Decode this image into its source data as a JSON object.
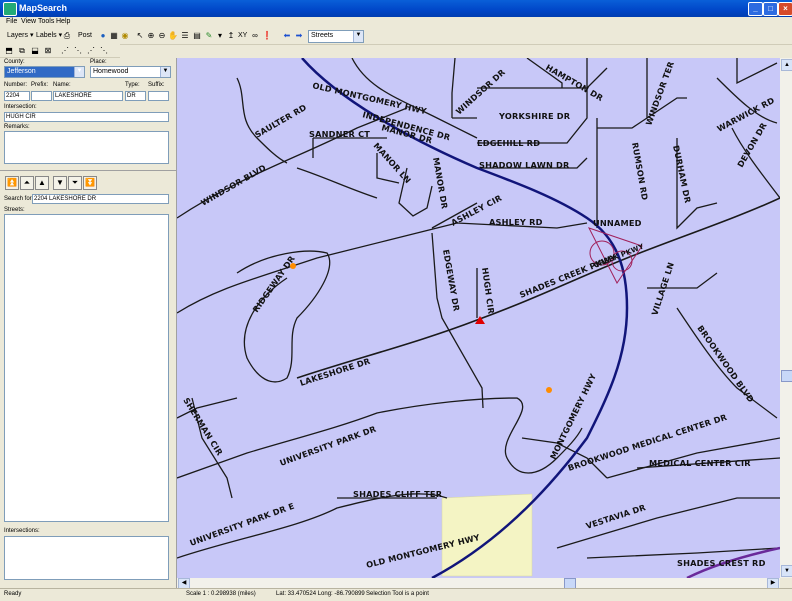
{
  "window": {
    "title": "MapSearch"
  },
  "menu": [
    "File",
    "View",
    "Tools",
    "Help"
  ],
  "toolbar": {
    "layers_label": "Layers",
    "labels_label": "Labels",
    "post_label": "Post",
    "xy_label": "XY",
    "layer_select": "Streets"
  },
  "search_panel": {
    "county_label": "County:",
    "county_value": "Jefferson",
    "place_label": "Place:",
    "place_value": "Homewood",
    "number_label": "Number:",
    "prefix_label": "Prefix:",
    "name_label": "Name:",
    "type_label": "Type:",
    "suffix_label": "Suffix:",
    "number_value": "2204",
    "prefix_value": "",
    "name_value": "LAKESHORE",
    "type_value": "DR",
    "suffix_value": "",
    "intersection_label": "Intersection:",
    "intersection_value": "HUGH CIR",
    "remarks_label": "Remarks:",
    "search_for_label": "Search for:",
    "search_for_value": "2204 LAKESHORE DR",
    "streets_label": "Streets:",
    "intersections_label": "Intersections:"
  },
  "map": {
    "labels": {
      "old_montgomery_hwy_top": "OLD MONTGOMERY HWY",
      "independence_dr": "INDEPENDENCE DR",
      "manor_dr": "MANOR DR",
      "manor_dr_vertical": "MANOR DR",
      "sandner_ct": "SANDNER CT",
      "manor_ln": "MANOR LN",
      "saulter_rd": "SAULTER RD",
      "windsor_dr": "WINDSOR DR",
      "hampton_dr": "HAMPTON DR",
      "yorkshire_dr": "YORKSHIRE DR",
      "edgehill_rd": "EDGEHILL RD",
      "shadow_lawn_dr": "SHADOW LAWN DR",
      "windsor_ter": "WINDSOR TER",
      "rumson_rd": "RUMSON RD",
      "durham_dr": "DURHAM DR",
      "warwick_rd": "WARWICK RD",
      "devon_dr": "DEVON DR",
      "windsor_blvd": "WINDSOR BLVD",
      "ashley_cir": "ASHLEY CIR",
      "ashley_rd": "ASHLEY RD",
      "unnamed": "UNNAMED",
      "shades_creek_pkwy_ramp": "CREEK PKWY",
      "shades_creek_pkwy": "SHADES CREEK PKWY",
      "edgeway_dr": "EDGEWAY DR",
      "hugh_cir": "HUGH CIR",
      "ridgeway_dr": "RIDGEWAY DR",
      "village_ln": "VILLAGE LN",
      "lakeshore_dr": "LAKESHORE DR",
      "montgomery_hwy": "MONTGOMERY HWY",
      "brookwood_blvd": "BROOKWOOD BLVD",
      "brookwood_medical_center_dr": "BROOKWOOD MEDICAL CENTER DR",
      "sherman_cir": "SHERMAN CIR",
      "university_park_dr": "UNIVERSITY PARK DR",
      "medical_center_cir": "MEDICAL CENTER CIR",
      "shades_cliff_ter": "SHADES CLIFF TER",
      "university_park_dr_e": "UNIVERSITY PARK DR E",
      "vestavia_dr": "VESTAVIA DR",
      "old_montgomery_hwy_bottom": "OLD MONTGOMERY HWY",
      "shades_crest_rd": "SHADES CREST RD"
    },
    "colors": {
      "background": "#c8c8f8",
      "highway": "#11157a",
      "park": "#f4f4c4",
      "marker_point": "#ff8c00",
      "marker_selected": "#e00000"
    }
  },
  "status": {
    "ready": "Ready",
    "scale": "Scale 1 : 0.298938 (miles)",
    "coords": "Lat: 33.470524 Long: -86.790899",
    "tool": "Selection Tool is a point"
  }
}
